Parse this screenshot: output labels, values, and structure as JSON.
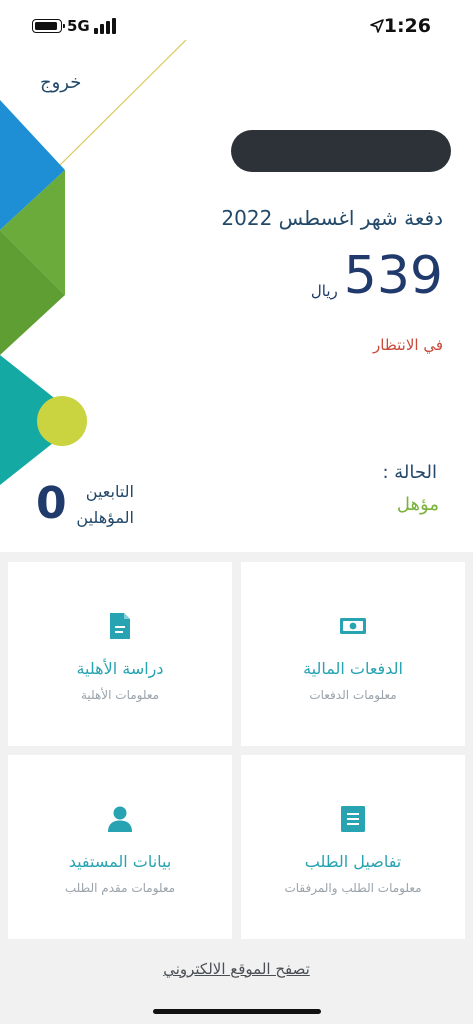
{
  "status_bar": {
    "network": "5G",
    "time": "1:26"
  },
  "header": {
    "logout_label": "خروج"
  },
  "payment": {
    "title": "دفعة شهر اغسطس 2022",
    "amount": "539",
    "currency": "ريال",
    "status_text": "في الانتظار"
  },
  "eligibility": {
    "label": "الحالة :",
    "value": "مؤهل"
  },
  "dependents": {
    "count": "0",
    "label_line1": "التابعين",
    "label_line2": "المؤهلين"
  },
  "cards": {
    "payments": {
      "title": "الدفعات المالية",
      "subtitle": "معلومات الدفعات",
      "icon": "money-icon"
    },
    "eligibility_study": {
      "title": "دراسة الأهلية",
      "subtitle": "معلومات الأهلية",
      "icon": "document-icon"
    },
    "request_details": {
      "title": "تفاصيل الطلب",
      "subtitle": "معلومات الطلب والمرفقات",
      "icon": "list-icon"
    },
    "beneficiary": {
      "title": "بيانات المستفيد",
      "subtitle": "معلومات مقدم الطلب",
      "icon": "user-icon"
    }
  },
  "footer": {
    "website_link": "تصفح الموقع الالكتروني"
  },
  "colors": {
    "accent_teal": "#27a3b1",
    "navy": "#1f3a6b",
    "pending_red": "#c94a3a",
    "eligible_green": "#79b23a"
  }
}
